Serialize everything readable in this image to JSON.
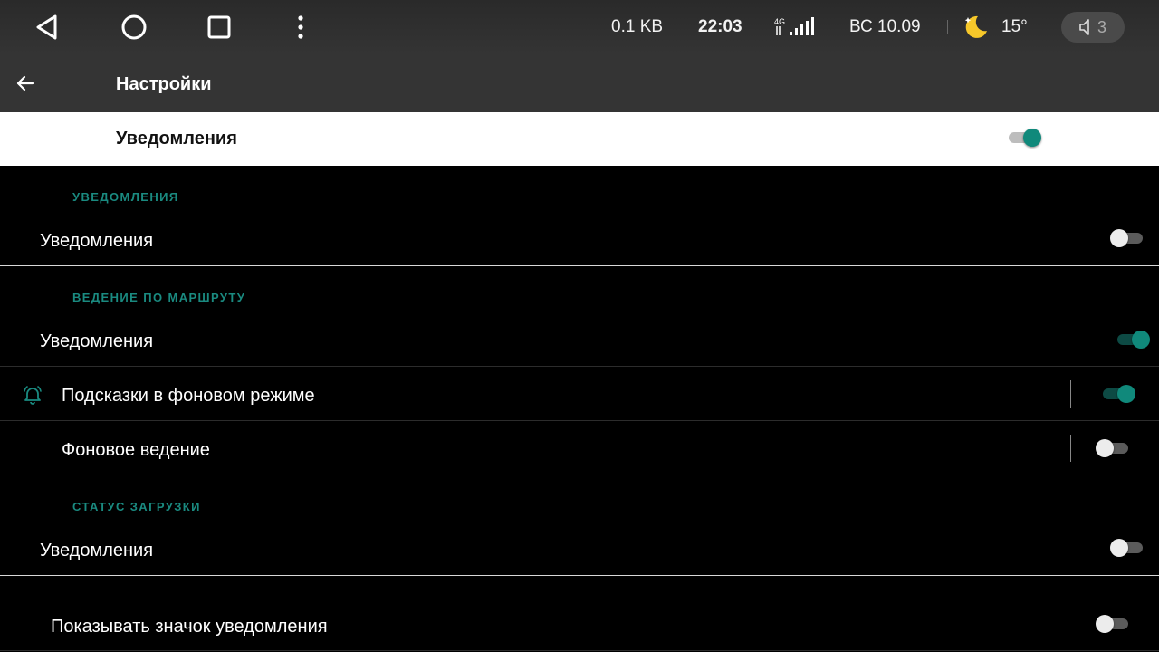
{
  "statusbar": {
    "network_speed": "0.1 KB",
    "time": "22:03",
    "network_type": "4G",
    "date": "ВС 10.09",
    "temperature": "15°",
    "volume_level": "3",
    "icons": [
      "back-triangle-icon",
      "home-circle-icon",
      "recents-square-icon",
      "more-vert-icon",
      "signal-icon",
      "weather-moon-icon",
      "volume-icon"
    ]
  },
  "appbar": {
    "title": "Настройки",
    "back_icon": "arrow-left-icon"
  },
  "master": {
    "label": "Уведомления",
    "enabled": true
  },
  "sections": [
    {
      "header": "УВЕДОМЛЕНИЯ",
      "rows": [
        {
          "label": "Уведомления",
          "enabled": false
        }
      ]
    },
    {
      "header": "ВЕДЕНИЕ ПО МАРШРУТУ",
      "rows": [
        {
          "label": "Уведомления",
          "enabled": true
        },
        {
          "label": "Подсказки в фоновом режиме",
          "enabled": true,
          "icon": "bell-icon"
        },
        {
          "label": "Фоновое ведение",
          "enabled": false
        }
      ]
    },
    {
      "header": "СТАТУС ЗАГРУЗКИ",
      "rows": [
        {
          "label": "Уведомления",
          "enabled": false
        }
      ]
    }
  ],
  "footer_row": {
    "label": "Показывать значок уведомления",
    "enabled": false
  },
  "colors": {
    "accent": "#10897b",
    "header_text": "#1a8a80",
    "appbar": "#343434",
    "background": "#000000"
  }
}
